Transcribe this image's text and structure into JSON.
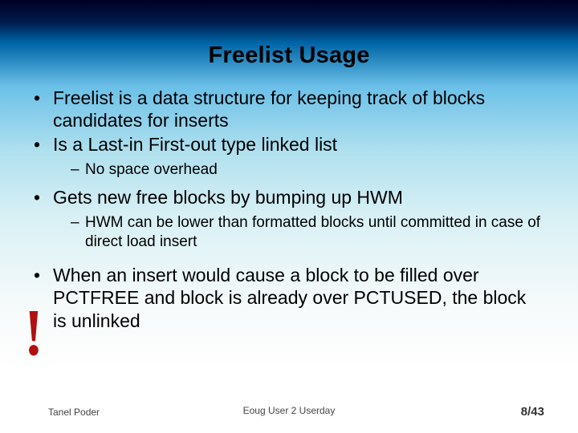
{
  "title": "Freelist Usage",
  "bullets": {
    "b1": "Freelist is a data structure for keeping track of blocks candidates for inserts",
    "b2": "Is a Last-in First-out type linked list",
    "b2s1": "No space overhead",
    "b3": "Gets new free blocks by bumping up HWM",
    "b3s1": "HWM can be lower than formatted blocks until committed in case of direct load insert",
    "b4": "When an insert would cause a block to be filled over PCTFREE and block is already over PCTUSED, the block is unlinked"
  },
  "callout": "!",
  "footer": {
    "author": "Tanel Poder",
    "event": "Eoug User 2 Userday",
    "page": "8/43"
  }
}
